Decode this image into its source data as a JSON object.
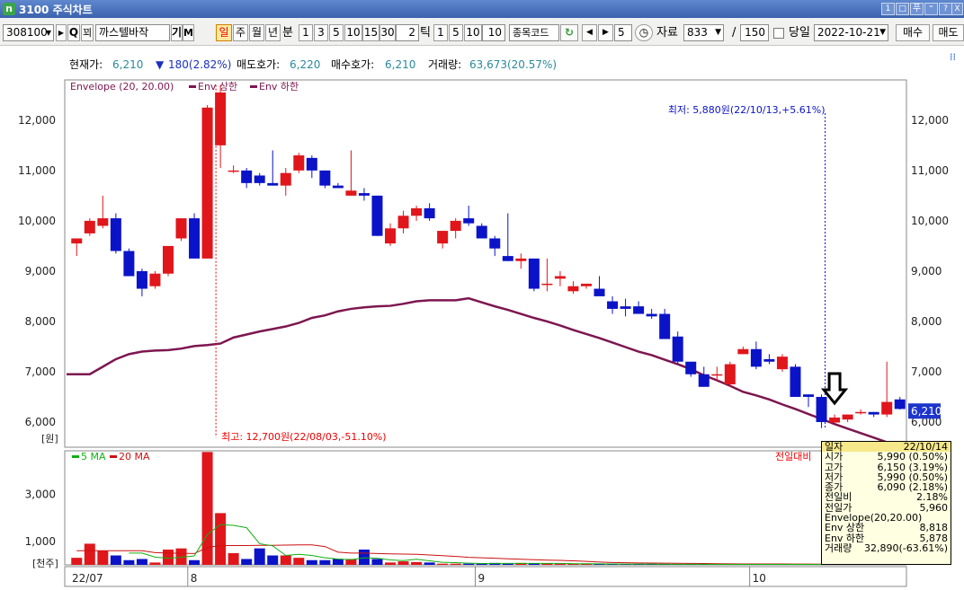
{
  "window": {
    "title": "3100 주식차트",
    "app_icon": "n",
    "buttons": [
      "1",
      "□",
      "푸",
      "⁼",
      "?",
      "X"
    ]
  },
  "toolbar": {
    "code": "308100",
    "name": "까스텔바작",
    "name_btns": [
      "기",
      "M"
    ],
    "search_glyph": "Q",
    "cart_label": "꾀",
    "period_tabs": [
      "일",
      "주",
      "월",
      "년"
    ],
    "minute_label": "분",
    "minute_options": [
      "1",
      "3",
      "5",
      "10",
      "15",
      "30"
    ],
    "tick_value": "2",
    "tick_label": "틱",
    "tick_options": [
      "1",
      "5",
      "10"
    ],
    "tick_input": "10",
    "code_field": "종목코드",
    "step_value": "5",
    "data_label": "자료",
    "count_value": "833",
    "slash": "/",
    "total_value": "150",
    "today_label": "당일",
    "date_value": "2022-10-21",
    "buy_label": "매수",
    "sell_label": "매도"
  },
  "infobar": {
    "cur_label": "현재가:",
    "cur_value": "6,210",
    "chg_value": "180(2.82%)",
    "ask_label": "매도호가:",
    "ask_value": "6,220",
    "bid_label": "매수호가:",
    "bid_value": "6,210",
    "vol_label": "거래량:",
    "vol_value": "63,673(20.57%)"
  },
  "colors": {
    "up": "#e0161b",
    "down": "#0b13c8",
    "env": "#7d1650",
    "ma5": "#10b010",
    "ma20": "#cc1111",
    "price_tag": "#1e35cc"
  },
  "chart_data": {
    "type": "candlestick",
    "price_legend": {
      "label": "Envelope (20, 20.00)",
      "upper": "Env 상한",
      "lower": "Env 하한"
    },
    "price_axis": {
      "ticks": [
        "12,000",
        "11,000",
        "10,000",
        "9,000",
        "8,000",
        "7,000",
        "6,000"
      ],
      "ylim": [
        5500,
        12800
      ],
      "unit": "[원]"
    },
    "current_price_tag": "6,210",
    "annotation_high": "최고: 12,700원(22/08/03,-51.10%)",
    "annotation_low": "최저: 5,880원(22/10/13,+5.61%)",
    "volume_legend": {
      "ma5": "5 MA",
      "ma20": "20 MA",
      "prev": "전일대비"
    },
    "volume_axis": {
      "ticks": [
        "3,000",
        "1,000"
      ],
      "ylim": [
        0,
        4850
      ],
      "unit": "[천주]"
    },
    "x_labels": [
      "22/07",
      "8",
      "9",
      "10"
    ],
    "candles": [
      {
        "o": 9550,
        "h": 9650,
        "l": 9300,
        "c": 9650
      },
      {
        "o": 9750,
        "h": 10050,
        "l": 9700,
        "c": 10000
      },
      {
        "o": 9900,
        "h": 10500,
        "l": 9850,
        "c": 10050
      },
      {
        "o": 10050,
        "h": 10150,
        "l": 9350,
        "c": 9400
      },
      {
        "o": 9400,
        "h": 9450,
        "l": 8900,
        "c": 8900
      },
      {
        "o": 9000,
        "h": 9050,
        "l": 8500,
        "c": 8650
      },
      {
        "o": 8700,
        "h": 9000,
        "l": 8650,
        "c": 8950
      },
      {
        "o": 8950,
        "h": 9450,
        "l": 8900,
        "c": 9500
      },
      {
        "o": 9650,
        "h": 10050,
        "l": 9600,
        "c": 10050
      },
      {
        "o": 10050,
        "h": 10150,
        "l": 9250,
        "c": 9250
      },
      {
        "o": 9250,
        "h": 12300,
        "l": 9250,
        "c": 12250
      },
      {
        "o": 11500,
        "h": 12700,
        "l": 11050,
        "c": 12550
      },
      {
        "o": 11000,
        "h": 11100,
        "l": 10950,
        "c": 11000
      },
      {
        "o": 11000,
        "h": 11050,
        "l": 10650,
        "c": 10750
      },
      {
        "o": 10900,
        "h": 10950,
        "l": 10700,
        "c": 10750
      },
      {
        "o": 10750,
        "h": 11400,
        "l": 10700,
        "c": 10700
      },
      {
        "o": 10700,
        "h": 11050,
        "l": 10500,
        "c": 10950
      },
      {
        "o": 11000,
        "h": 11350,
        "l": 10950,
        "c": 11300
      },
      {
        "o": 11250,
        "h": 11300,
        "l": 10850,
        "c": 11000
      },
      {
        "o": 11000,
        "h": 11000,
        "l": 10650,
        "c": 10700
      },
      {
        "o": 10700,
        "h": 10750,
        "l": 10650,
        "c": 10650
      },
      {
        "o": 10500,
        "h": 11400,
        "l": 10500,
        "c": 10600
      },
      {
        "o": 10550,
        "h": 10650,
        "l": 10400,
        "c": 10500
      },
      {
        "o": 10500,
        "h": 10500,
        "l": 9700,
        "c": 9700
      },
      {
        "o": 9550,
        "h": 9950,
        "l": 9500,
        "c": 9850
      },
      {
        "o": 9850,
        "h": 10200,
        "l": 9750,
        "c": 10100
      },
      {
        "o": 10100,
        "h": 10300,
        "l": 10000,
        "c": 10250
      },
      {
        "o": 10250,
        "h": 10350,
        "l": 10000,
        "c": 10050
      },
      {
        "o": 9550,
        "h": 9800,
        "l": 9450,
        "c": 9800
      },
      {
        "o": 9800,
        "h": 10050,
        "l": 9650,
        "c": 10000
      },
      {
        "o": 10050,
        "h": 10300,
        "l": 9900,
        "c": 9950
      },
      {
        "o": 9900,
        "h": 9950,
        "l": 9650,
        "c": 9650
      },
      {
        "o": 9650,
        "h": 9700,
        "l": 9300,
        "c": 9450
      },
      {
        "o": 9300,
        "h": 10150,
        "l": 9200,
        "c": 9200
      },
      {
        "o": 9200,
        "h": 9350,
        "l": 9050,
        "c": 9250
      },
      {
        "o": 9250,
        "h": 9250,
        "l": 8600,
        "c": 8650
      },
      {
        "o": 8750,
        "h": 9250,
        "l": 8600,
        "c": 8750
      },
      {
        "o": 8850,
        "h": 9000,
        "l": 8700,
        "c": 8900
      },
      {
        "o": 8600,
        "h": 8800,
        "l": 8550,
        "c": 8700
      },
      {
        "o": 8700,
        "h": 8750,
        "l": 8650,
        "c": 8750
      },
      {
        "o": 8650,
        "h": 8900,
        "l": 8600,
        "c": 8500
      },
      {
        "o": 8400,
        "h": 8500,
        "l": 8150,
        "c": 8250
      },
      {
        "o": 8300,
        "h": 8450,
        "l": 8100,
        "c": 8250
      },
      {
        "o": 8300,
        "h": 8400,
        "l": 8150,
        "c": 8150
      },
      {
        "o": 8150,
        "h": 8250,
        "l": 8050,
        "c": 8100
      },
      {
        "o": 8150,
        "h": 8250,
        "l": 7700,
        "c": 7650
      },
      {
        "o": 7700,
        "h": 7800,
        "l": 7150,
        "c": 7200
      },
      {
        "o": 7200,
        "h": 7200,
        "l": 6900,
        "c": 6950
      },
      {
        "o": 6950,
        "h": 7100,
        "l": 6700,
        "c": 6700
      },
      {
        "o": 6950,
        "h": 7100,
        "l": 6800,
        "c": 6950
      },
      {
        "o": 6750,
        "h": 7200,
        "l": 6700,
        "c": 7150
      },
      {
        "o": 7350,
        "h": 7500,
        "l": 7350,
        "c": 7450
      },
      {
        "o": 7450,
        "h": 7600,
        "l": 7050,
        "c": 7100
      },
      {
        "o": 7250,
        "h": 7350,
        "l": 7150,
        "c": 7200
      },
      {
        "o": 7050,
        "h": 7350,
        "l": 7000,
        "c": 7300
      },
      {
        "o": 7100,
        "h": 7150,
        "l": 6500,
        "c": 6500
      },
      {
        "o": 6550,
        "h": 6550,
        "l": 6300,
        "c": 6500
      },
      {
        "o": 6500,
        "h": 6550,
        "l": 5880,
        "c": 6000
      },
      {
        "o": 5990,
        "h": 6150,
        "l": 5990,
        "c": 6090
      },
      {
        "o": 6050,
        "h": 6150,
        "l": 6000,
        "c": 6150
      },
      {
        "o": 6200,
        "h": 6250,
        "l": 6150,
        "c": 6200
      },
      {
        "o": 6200,
        "h": 6200,
        "l": 6100,
        "c": 6150
      },
      {
        "o": 6150,
        "h": 7200,
        "l": 6100,
        "c": 6400
      },
      {
        "o": 6450,
        "h": 6500,
        "l": 6250,
        "c": 6260
      }
    ],
    "envelope_lower": [
      6950,
      6950,
      7100,
      7250,
      7350,
      7400,
      7420,
      7430,
      7460,
      7510,
      7530,
      7560,
      7680,
      7740,
      7800,
      7850,
      7900,
      7970,
      8070,
      8120,
      8200,
      8250,
      8280,
      8300,
      8310,
      8350,
      8400,
      8420,
      8420,
      8420,
      8460,
      8380,
      8300,
      8230,
      8150,
      8070,
      8000,
      7920,
      7830,
      7750,
      7670,
      7580,
      7490,
      7400,
      7330,
      7240,
      7150,
      7050,
      6930,
      6830,
      6720,
      6600,
      6530,
      6450,
      6350,
      6260,
      6160,
      6060,
      5960,
      5870,
      5780,
      5690,
      5600,
      5510
    ],
    "volume": [
      300,
      900,
      600,
      400,
      200,
      250,
      100,
      650,
      700,
      200,
      4800,
      2200,
      500,
      250,
      700,
      400,
      400,
      300,
      200,
      200,
      250,
      250,
      650,
      250,
      100,
      150,
      120,
      100,
      50,
      50,
      50,
      50,
      80,
      50,
      80,
      60,
      60,
      50,
      40,
      40,
      40,
      30,
      30,
      30,
      30,
      20,
      20,
      20,
      20,
      20,
      20,
      20,
      20,
      20,
      20,
      20,
      20,
      20,
      20,
      20,
      20,
      20,
      20,
      20
    ],
    "volume_ma5": [
      null,
      null,
      null,
      null,
      500,
      500,
      330,
      280,
      320,
      380,
      1290,
      1710,
      1680,
      1580,
      900,
      810,
      400,
      450,
      400,
      300,
      250,
      220,
      300,
      280,
      210,
      180,
      240,
      170,
      110,
      95,
      70,
      55,
      60,
      60,
      60,
      60,
      62,
      60,
      50,
      48,
      45,
      40,
      35,
      33,
      32,
      28,
      25,
      23,
      22,
      20,
      20,
      20,
      20,
      20,
      20,
      20,
      20,
      20,
      20,
      20,
      20,
      20,
      20,
      20
    ],
    "volume_ma20": [
      600,
      600,
      600,
      600,
      600,
      600,
      520,
      500,
      490,
      480,
      740,
      820,
      820,
      820,
      830,
      830,
      840,
      850,
      850,
      780,
      540,
      500,
      500,
      480,
      470,
      460,
      450,
      420,
      390,
      360,
      320,
      300,
      280,
      260,
      240,
      220,
      200,
      190,
      170,
      150,
      120,
      100,
      90,
      80,
      75,
      70,
      65,
      60,
      55,
      50,
      45,
      40,
      40,
      38,
      36,
      34,
      32,
      30,
      30,
      30,
      28,
      28,
      28,
      28
    ],
    "tooltip": [
      {
        "k": "일자",
        "v": "22/10/14"
      },
      {
        "k": "시가",
        "v": "5,990  (0.50%)"
      },
      {
        "k": "고가",
        "v": "6,150  (3.19%)"
      },
      {
        "k": "저가",
        "v": "5,990  (0.50%)"
      },
      {
        "k": "종가",
        "v": "6,090  (2.18%)"
      },
      {
        "k": "전일비",
        "v": "2.18%"
      },
      {
        "k": "전일가",
        "v": "5,960"
      },
      {
        "k": "Envelope(20,20.00)",
        "v": ""
      },
      {
        "k": "Env 상한",
        "v": "8,818"
      },
      {
        "k": "Env 하한",
        "v": "5,878"
      },
      {
        "k": "거래량",
        "v": "32,890(-63.61%)"
      }
    ]
  }
}
